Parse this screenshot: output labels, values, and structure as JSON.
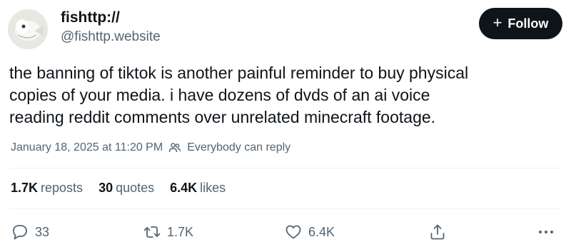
{
  "author": {
    "display_name": "fishttp://",
    "handle": "@fishttp.website",
    "avatar_icon": "fish-avatar-icon"
  },
  "follow_button": {
    "plus": "+",
    "label": "Follow"
  },
  "tweet": {
    "lines": [
      "the banning of tiktok is another painful reminder to buy physical",
      "copies of your media. i have dozens of dvds of an ai voice",
      "reading reddit comments over unrelated minecraft footage."
    ]
  },
  "meta": {
    "timestamp": "January 18, 2025 at 11:20 PM",
    "reply_icon": "people-icon",
    "reply_setting": "Everybody can reply"
  },
  "stats": {
    "reposts_count": "1.7K",
    "reposts_label": "reposts",
    "quotes_count": "30",
    "quotes_label": "quotes",
    "likes_count": "6.4K",
    "likes_label": "likes"
  },
  "actions": {
    "reply": {
      "icon": "reply-icon",
      "count": "33"
    },
    "repost": {
      "icon": "repost-icon",
      "count": "1.7K"
    },
    "like": {
      "icon": "heart-icon",
      "count": "6.4K"
    },
    "share": {
      "icon": "share-icon"
    },
    "more": {
      "icon": "more-icon"
    }
  },
  "colors": {
    "text_primary": "#0f1419",
    "text_secondary": "#536471",
    "button_bg": "#0f1419",
    "divider": "#eff3f4"
  }
}
